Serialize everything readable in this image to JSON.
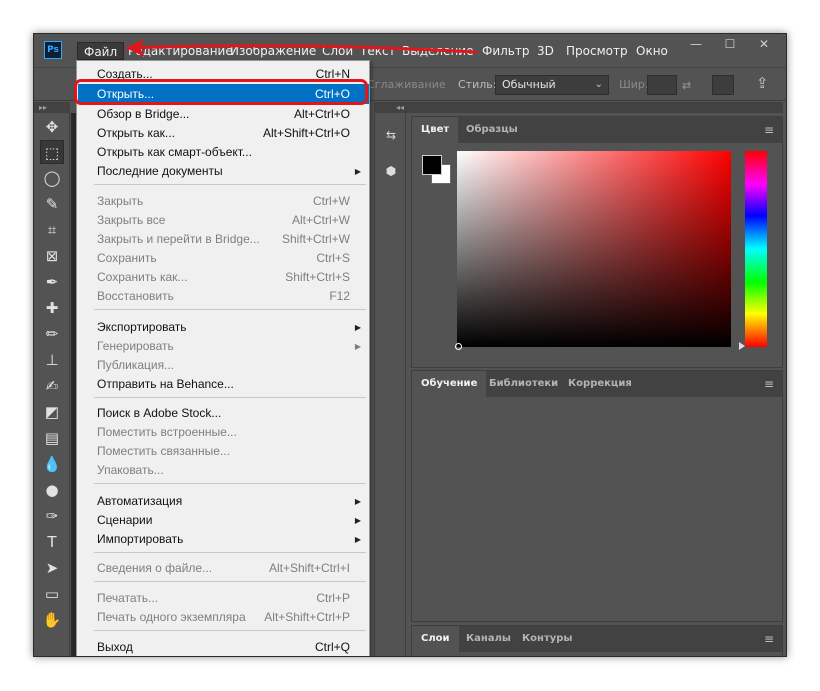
{
  "app": {
    "logo": "Ps",
    "menubar": [
      "Файл",
      "Редактирование",
      "Изображение",
      "Слои",
      "Текст",
      "Выделение",
      "Фильтр",
      "3D",
      "Просмотр",
      "Окно"
    ],
    "window_controls": [
      "minimize-icon",
      "maximize-icon",
      "close-icon"
    ]
  },
  "options_bar": {
    "smoothing_label": "Сглаживание",
    "style_label": "Стиль:",
    "style_value": "Обычный",
    "width_label": "Шир.:"
  },
  "panels": {
    "color": {
      "tabs": [
        "Цвет",
        "Образцы"
      ],
      "foreground": "#000000",
      "background": "#ffffff",
      "hue": "#ff0000"
    },
    "learn": {
      "tabs": [
        "Обучение",
        "Библиотеки",
        "Коррекция"
      ]
    },
    "layers": {
      "tabs": [
        "Слои",
        "Каналы",
        "Контуры"
      ]
    }
  },
  "file_menu": {
    "items": [
      {
        "label": "Создать...",
        "shortcut": "Ctrl+N",
        "enabled": true,
        "partial": true
      },
      {
        "label": "Открыть...",
        "shortcut": "Ctrl+O",
        "enabled": true,
        "highlighted": true
      },
      {
        "label": "Обзор в Bridge...",
        "shortcut": "Alt+Ctrl+O",
        "enabled": true
      },
      {
        "label": "Открыть как...",
        "shortcut": "Alt+Shift+Ctrl+O",
        "enabled": true
      },
      {
        "label": "Открыть как смарт-объект...",
        "shortcut": "",
        "enabled": true
      },
      {
        "label": "Последние документы",
        "shortcut": "",
        "enabled": true,
        "submenu": true
      },
      {
        "label": "Закрыть",
        "shortcut": "Ctrl+W",
        "enabled": false
      },
      {
        "label": "Закрыть все",
        "shortcut": "Alt+Ctrl+W",
        "enabled": false
      },
      {
        "label": "Закрыть и перейти в Bridge...",
        "shortcut": "Shift+Ctrl+W",
        "enabled": false
      },
      {
        "label": "Сохранить",
        "shortcut": "Ctrl+S",
        "enabled": false
      },
      {
        "label": "Сохранить как...",
        "shortcut": "Shift+Ctrl+S",
        "enabled": false
      },
      {
        "label": "Восстановить",
        "shortcut": "F12",
        "enabled": false
      },
      {
        "label": "Экспортировать",
        "shortcut": "",
        "enabled": true,
        "submenu": true
      },
      {
        "label": "Генерировать",
        "shortcut": "",
        "enabled": false,
        "submenu": true
      },
      {
        "label": "Публикация...",
        "shortcut": "",
        "enabled": false
      },
      {
        "label": "Отправить на Behance...",
        "shortcut": "",
        "enabled": true
      },
      {
        "label": "Поиск в Adobe Stock...",
        "shortcut": "",
        "enabled": true
      },
      {
        "label": "Поместить встроенные...",
        "shortcut": "",
        "enabled": false
      },
      {
        "label": "Поместить связанные...",
        "shortcut": "",
        "enabled": false
      },
      {
        "label": "Упаковать...",
        "shortcut": "",
        "enabled": false
      },
      {
        "label": "Автоматизация",
        "shortcut": "",
        "enabled": true,
        "submenu": true
      },
      {
        "label": "Сценарии",
        "shortcut": "",
        "enabled": true,
        "submenu": true
      },
      {
        "label": "Импортировать",
        "shortcut": "",
        "enabled": true,
        "submenu": true
      },
      {
        "label": "Сведения о файле...",
        "shortcut": "Alt+Shift+Ctrl+I",
        "enabled": false
      },
      {
        "label": "Печатать...",
        "shortcut": "Ctrl+P",
        "enabled": false
      },
      {
        "label": "Печать одного экземпляра",
        "shortcut": "Alt+Shift+Ctrl+P",
        "enabled": false
      },
      {
        "label": "Выход",
        "shortcut": "Ctrl+Q",
        "enabled": true
      }
    ]
  },
  "tools": [
    "move-tool-icon",
    "rect-marquee-tool-icon",
    "lasso-tool-icon",
    "quick-select-tool-icon",
    "crop-tool-icon",
    "frame-tool-icon",
    "eyedropper-tool-icon",
    "healing-brush-tool-icon",
    "brush-tool-icon",
    "clone-stamp-tool-icon",
    "history-brush-tool-icon",
    "eraser-tool-icon",
    "gradient-tool-icon",
    "blur-tool-icon",
    "dodge-tool-icon",
    "pen-tool-icon",
    "type-tool-icon",
    "path-select-tool-icon",
    "rectangle-tool-icon",
    "hand-tool-icon"
  ],
  "annotation_color": "#e0161c",
  "highlight_color": "#0071c5"
}
